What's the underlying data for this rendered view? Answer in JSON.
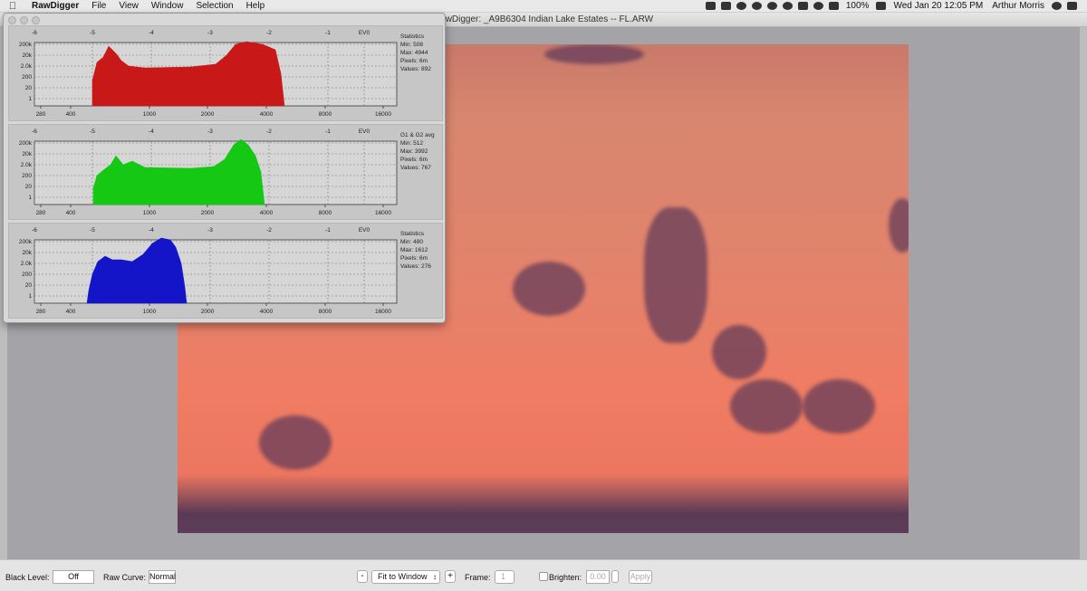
{
  "menubar": {
    "app_name": "RawDigger",
    "items": [
      "File",
      "View",
      "Window",
      "Selection",
      "Help"
    ],
    "battery": "100%",
    "datetime": "Wed Jan 20  12:05 PM",
    "user": "Arthur Morris"
  },
  "window": {
    "title": "RawDigger: _A9B6304  Indian Lake Estates -- FL.ARW"
  },
  "histogram": {
    "ev_ticks": [
      "-6",
      "-5",
      "-4",
      "-3",
      "-2",
      "-1",
      "EV0"
    ],
    "y_ticks": [
      "200k",
      "20k",
      "2.0k",
      "200",
      "20",
      "1"
    ],
    "x_ticks": [
      "280",
      "400",
      "1000",
      "2000",
      "4000",
      "8000",
      "16000"
    ],
    "panels": [
      {
        "color": "#c81818",
        "stats_title": "Statistics",
        "min": "Min: 508",
        "max": "Max: 4944",
        "pixels": "Pixels: 6m",
        "values": "Values: 892"
      },
      {
        "color": "#14c814",
        "stats_title": "G1 & G2 avg",
        "min": "Min: 512",
        "max": "Max: 3992",
        "pixels": "Pixels: 6m",
        "values": "Values: 767"
      },
      {
        "color": "#1414c8",
        "stats_title": "Statistics",
        "min": "Min: 480",
        "max": "Max: 1612",
        "pixels": "Pixels: 6m",
        "values": "Values: 276"
      }
    ]
  },
  "toolbar": {
    "black_level_label": "Black Level:",
    "black_level_value": "Off",
    "raw_curve_label": "Raw Curve:",
    "raw_curve_value": "Normal",
    "zoom_out": "-",
    "zoom_mode": "Fit to Window",
    "zoom_in": "+",
    "frame_label": "Frame:",
    "frame_value": "1",
    "brighten_label": "Brighten:",
    "brighten_value": "0.00",
    "apply_label": "Apply"
  }
}
